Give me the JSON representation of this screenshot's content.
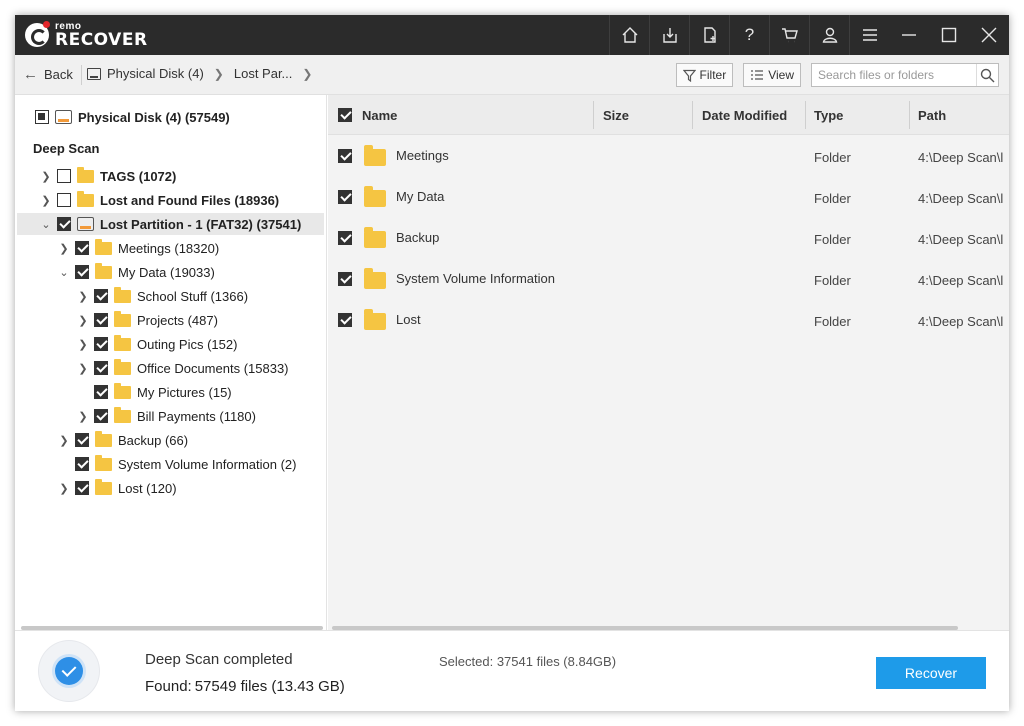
{
  "app": {
    "logo_small": "remo",
    "logo_big": "RECOVER",
    "toolbar_icons": [
      "home-icon",
      "save-session-icon",
      "new-file-icon",
      "help-icon",
      "cart-icon",
      "user-icon",
      "menu-icon"
    ],
    "help_glyph": "?"
  },
  "nav": {
    "back_label": "Back",
    "crumbs": [
      "Physical Disk (4)",
      "Lost Par..."
    ],
    "filter_label": "Filter",
    "view_label": "View",
    "search_placeholder": "Search files or folders"
  },
  "tree": {
    "root_label": "Physical Disk (4) (57549)",
    "section_label": "Deep Scan",
    "items": [
      {
        "label": "TAGS (1072)"
      },
      {
        "label": "Lost and Found Files (18936)"
      },
      {
        "label": "Lost Partition - 1 (FAT32) (37541)"
      },
      {
        "label": "Meetings (18320)"
      },
      {
        "label": "My Data (19033)"
      },
      {
        "label": "School Stuff (1366)"
      },
      {
        "label": "Projects (487)"
      },
      {
        "label": "Outing Pics (152)"
      },
      {
        "label": "Office Documents (15833)"
      },
      {
        "label": "My Pictures (15)"
      },
      {
        "label": "Bill Payments (1180)"
      },
      {
        "label": "Backup (66)"
      },
      {
        "label": "System Volume Information (2)"
      },
      {
        "label": "Lost (120)"
      }
    ]
  },
  "table": {
    "columns": [
      "Name",
      "Size",
      "Date Modified",
      "Type",
      "Path"
    ],
    "rows": [
      {
        "name": "Meetings",
        "size": "",
        "date": "",
        "type": "Folder",
        "path": "4:\\Deep Scan\\l"
      },
      {
        "name": "My Data",
        "size": "",
        "date": "",
        "type": "Folder",
        "path": "4:\\Deep Scan\\l"
      },
      {
        "name": "Backup",
        "size": "",
        "date": "",
        "type": "Folder",
        "path": "4:\\Deep Scan\\l"
      },
      {
        "name": "System Volume Information",
        "size": "",
        "date": "",
        "type": "Folder",
        "path": "4:\\Deep Scan\\l"
      },
      {
        "name": "Lost",
        "size": "",
        "date": "",
        "type": "Folder",
        "path": "4:\\Deep Scan\\l"
      }
    ]
  },
  "status": {
    "title": "Deep Scan completed",
    "found_label": "Found:",
    "found_value": "57549 files (13.43 GB)",
    "selected": "Selected: 37541 files (8.84GB)",
    "recover_label": "Recover"
  },
  "colors": {
    "titlebar": "#2b2b2b",
    "accent": "#1e9be9",
    "folder": "#f5c542"
  }
}
